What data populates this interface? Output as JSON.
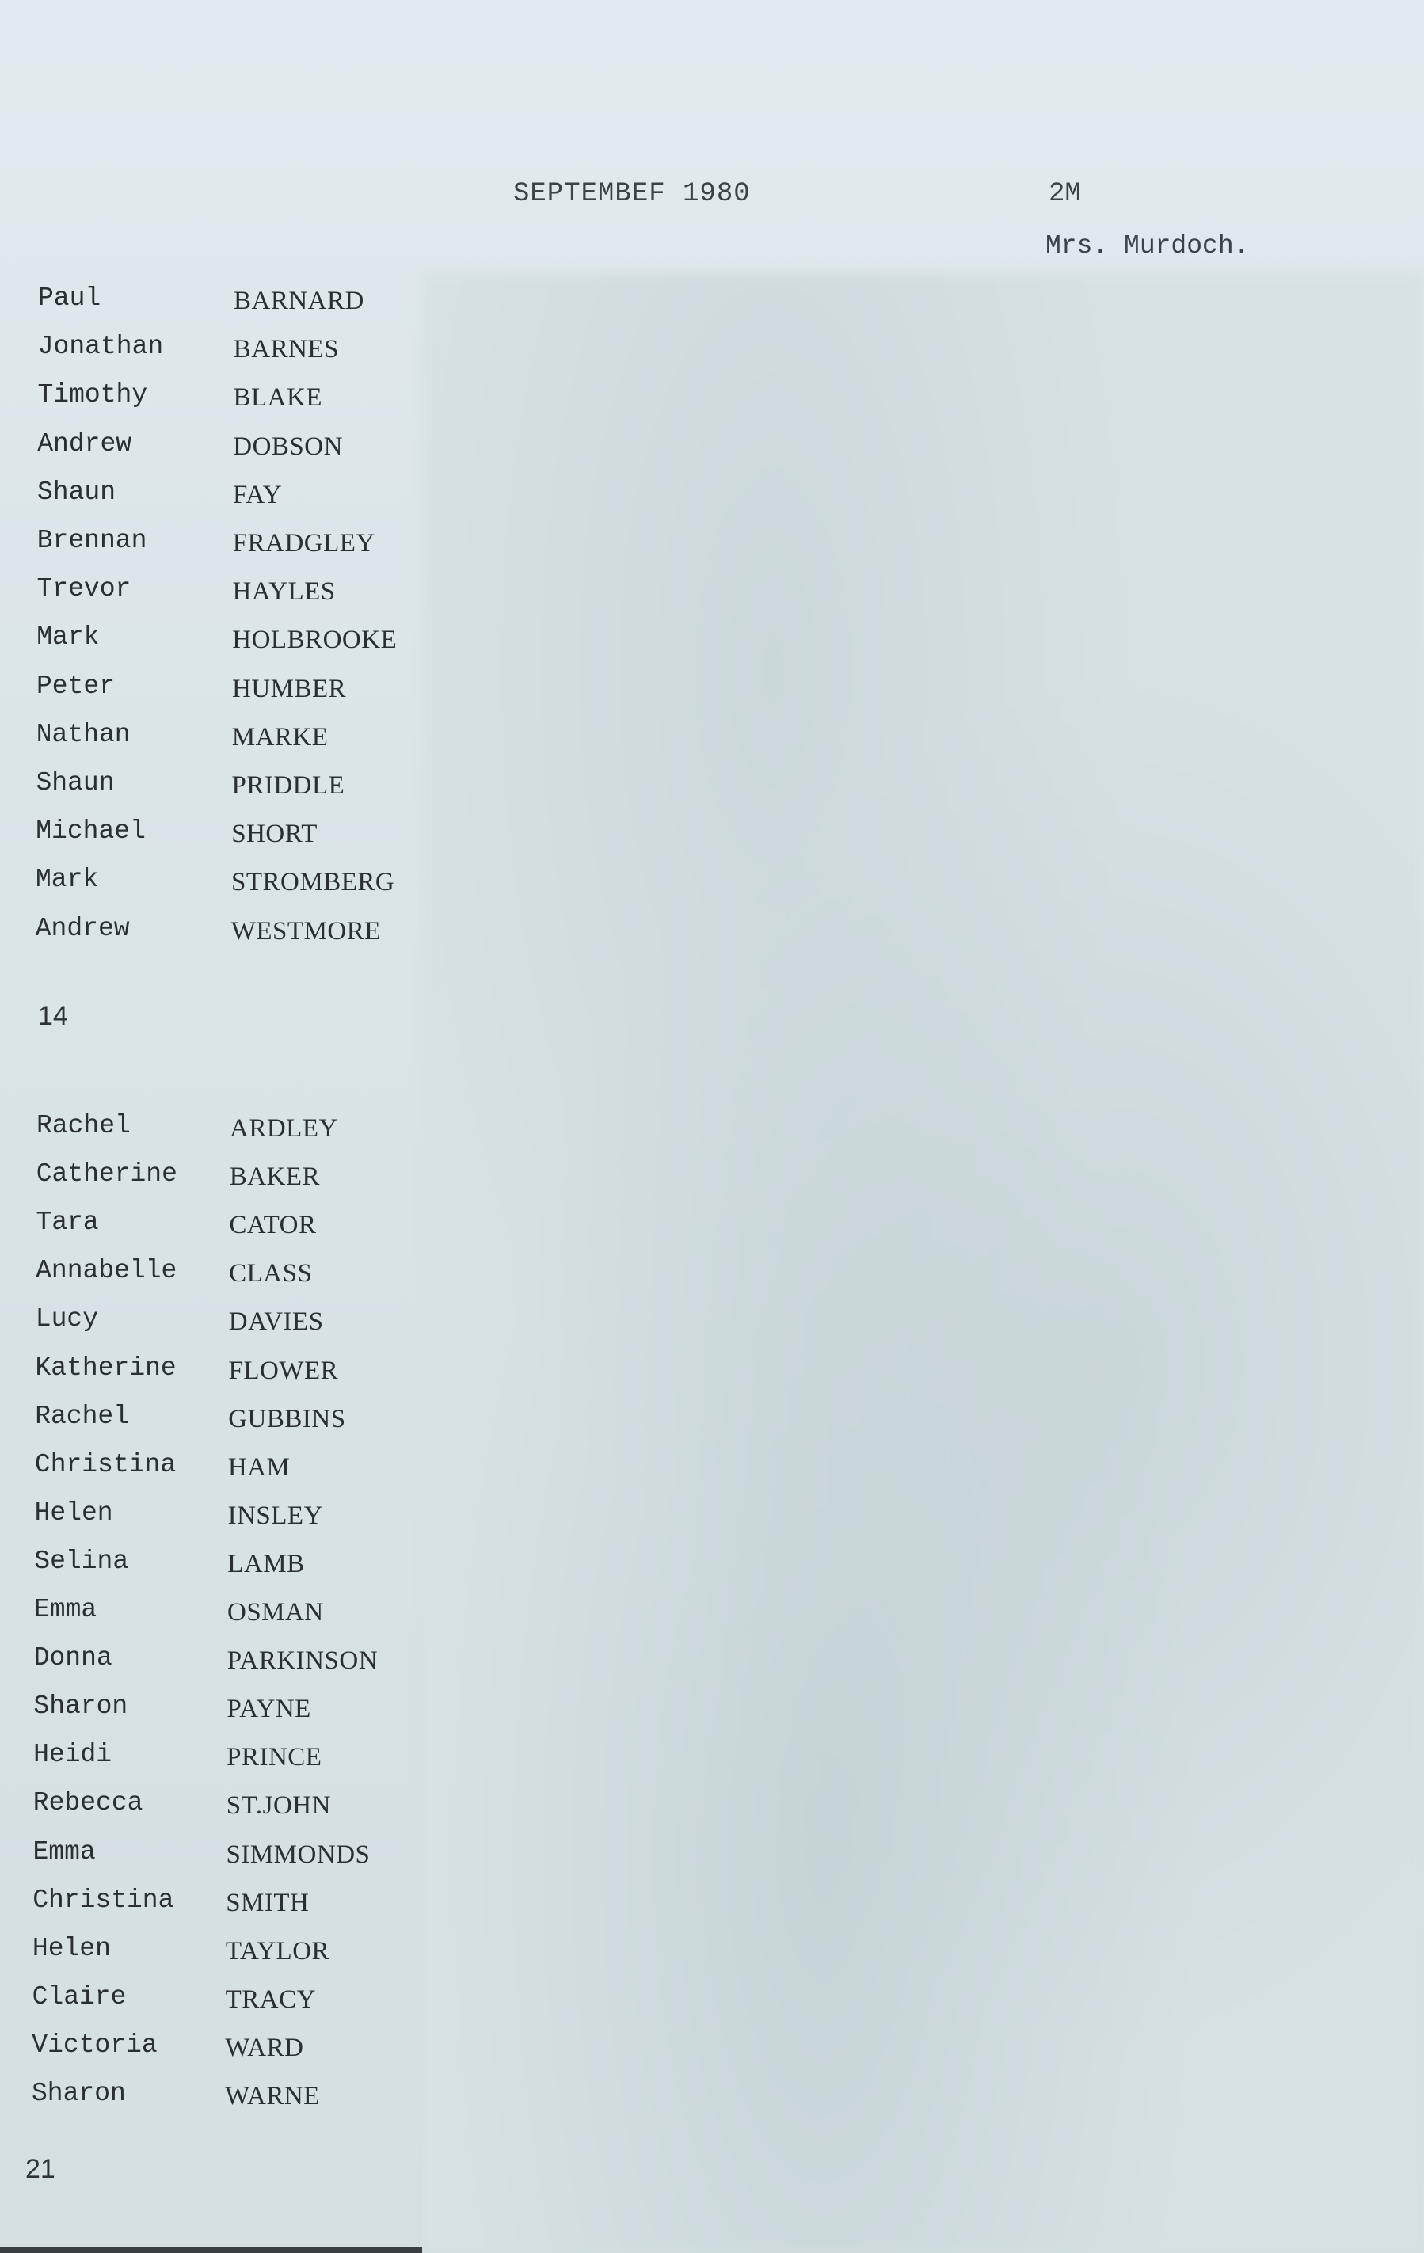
{
  "header": {
    "date": "SEPTEMBEF 1980",
    "class_code": "2M",
    "teacher": "Mrs. Murdoch."
  },
  "boys": [
    {
      "first": "Paul",
      "last": "BARNARD"
    },
    {
      "first": "Jonathan",
      "last": "BARNES"
    },
    {
      "first": "Timothy",
      "last": "BLAKE"
    },
    {
      "first": "Andrew",
      "last": "DOBSON"
    },
    {
      "first": "Shaun",
      "last": "FAY"
    },
    {
      "first": "Brennan",
      "last": "FRADGLEY"
    },
    {
      "first": "Trevor",
      "last": "HAYLES"
    },
    {
      "first": "Mark",
      "last": "HOLBROOKE"
    },
    {
      "first": "Peter",
      "last": "HUMBER"
    },
    {
      "first": "Nathan",
      "last": "MARKE"
    },
    {
      "first": "Shaun",
      "last": "PRIDDLE"
    },
    {
      "first": "Michael",
      "last": "SHORT"
    },
    {
      "first": "Mark",
      "last": "STROMBERG"
    },
    {
      "first": "Andrew",
      "last": "WESTMORE"
    }
  ],
  "boys_count": "14",
  "girls": [
    {
      "first": "Rachel",
      "last": "ARDLEY"
    },
    {
      "first": "Catherine",
      "last": "BAKER"
    },
    {
      "first": "Tara",
      "last": "CATOR"
    },
    {
      "first": "Annabelle",
      "last": "CLASS"
    },
    {
      "first": "Lucy",
      "last": "DAVIES"
    },
    {
      "first": "Katherine",
      "last": "FLOWER"
    },
    {
      "first": "Rachel",
      "last": "GUBBINS"
    },
    {
      "first": "Christina",
      "last": "HAM"
    },
    {
      "first": "Helen",
      "last": "INSLEY"
    },
    {
      "first": "Selina",
      "last": "LAMB"
    },
    {
      "first": "Emma",
      "last": "OSMAN"
    },
    {
      "first": "Donna",
      "last": "PARKINSON"
    },
    {
      "first": "Sharon",
      "last": "PAYNE"
    },
    {
      "first": "Heidi",
      "last": "PRINCE"
    },
    {
      "first": "Rebecca",
      "last": "ST.JOHN"
    },
    {
      "first": "Emma",
      "last": "SIMMONDS"
    },
    {
      "first": "Christina",
      "last": "SMITH"
    },
    {
      "first": "Helen",
      "last": "TAYLOR"
    },
    {
      "first": "Claire",
      "last": "TRACY"
    },
    {
      "first": "Victoria",
      "last": "WARD"
    },
    {
      "first": "Sharon",
      "last": "WARNE"
    }
  ],
  "girls_count": "21"
}
